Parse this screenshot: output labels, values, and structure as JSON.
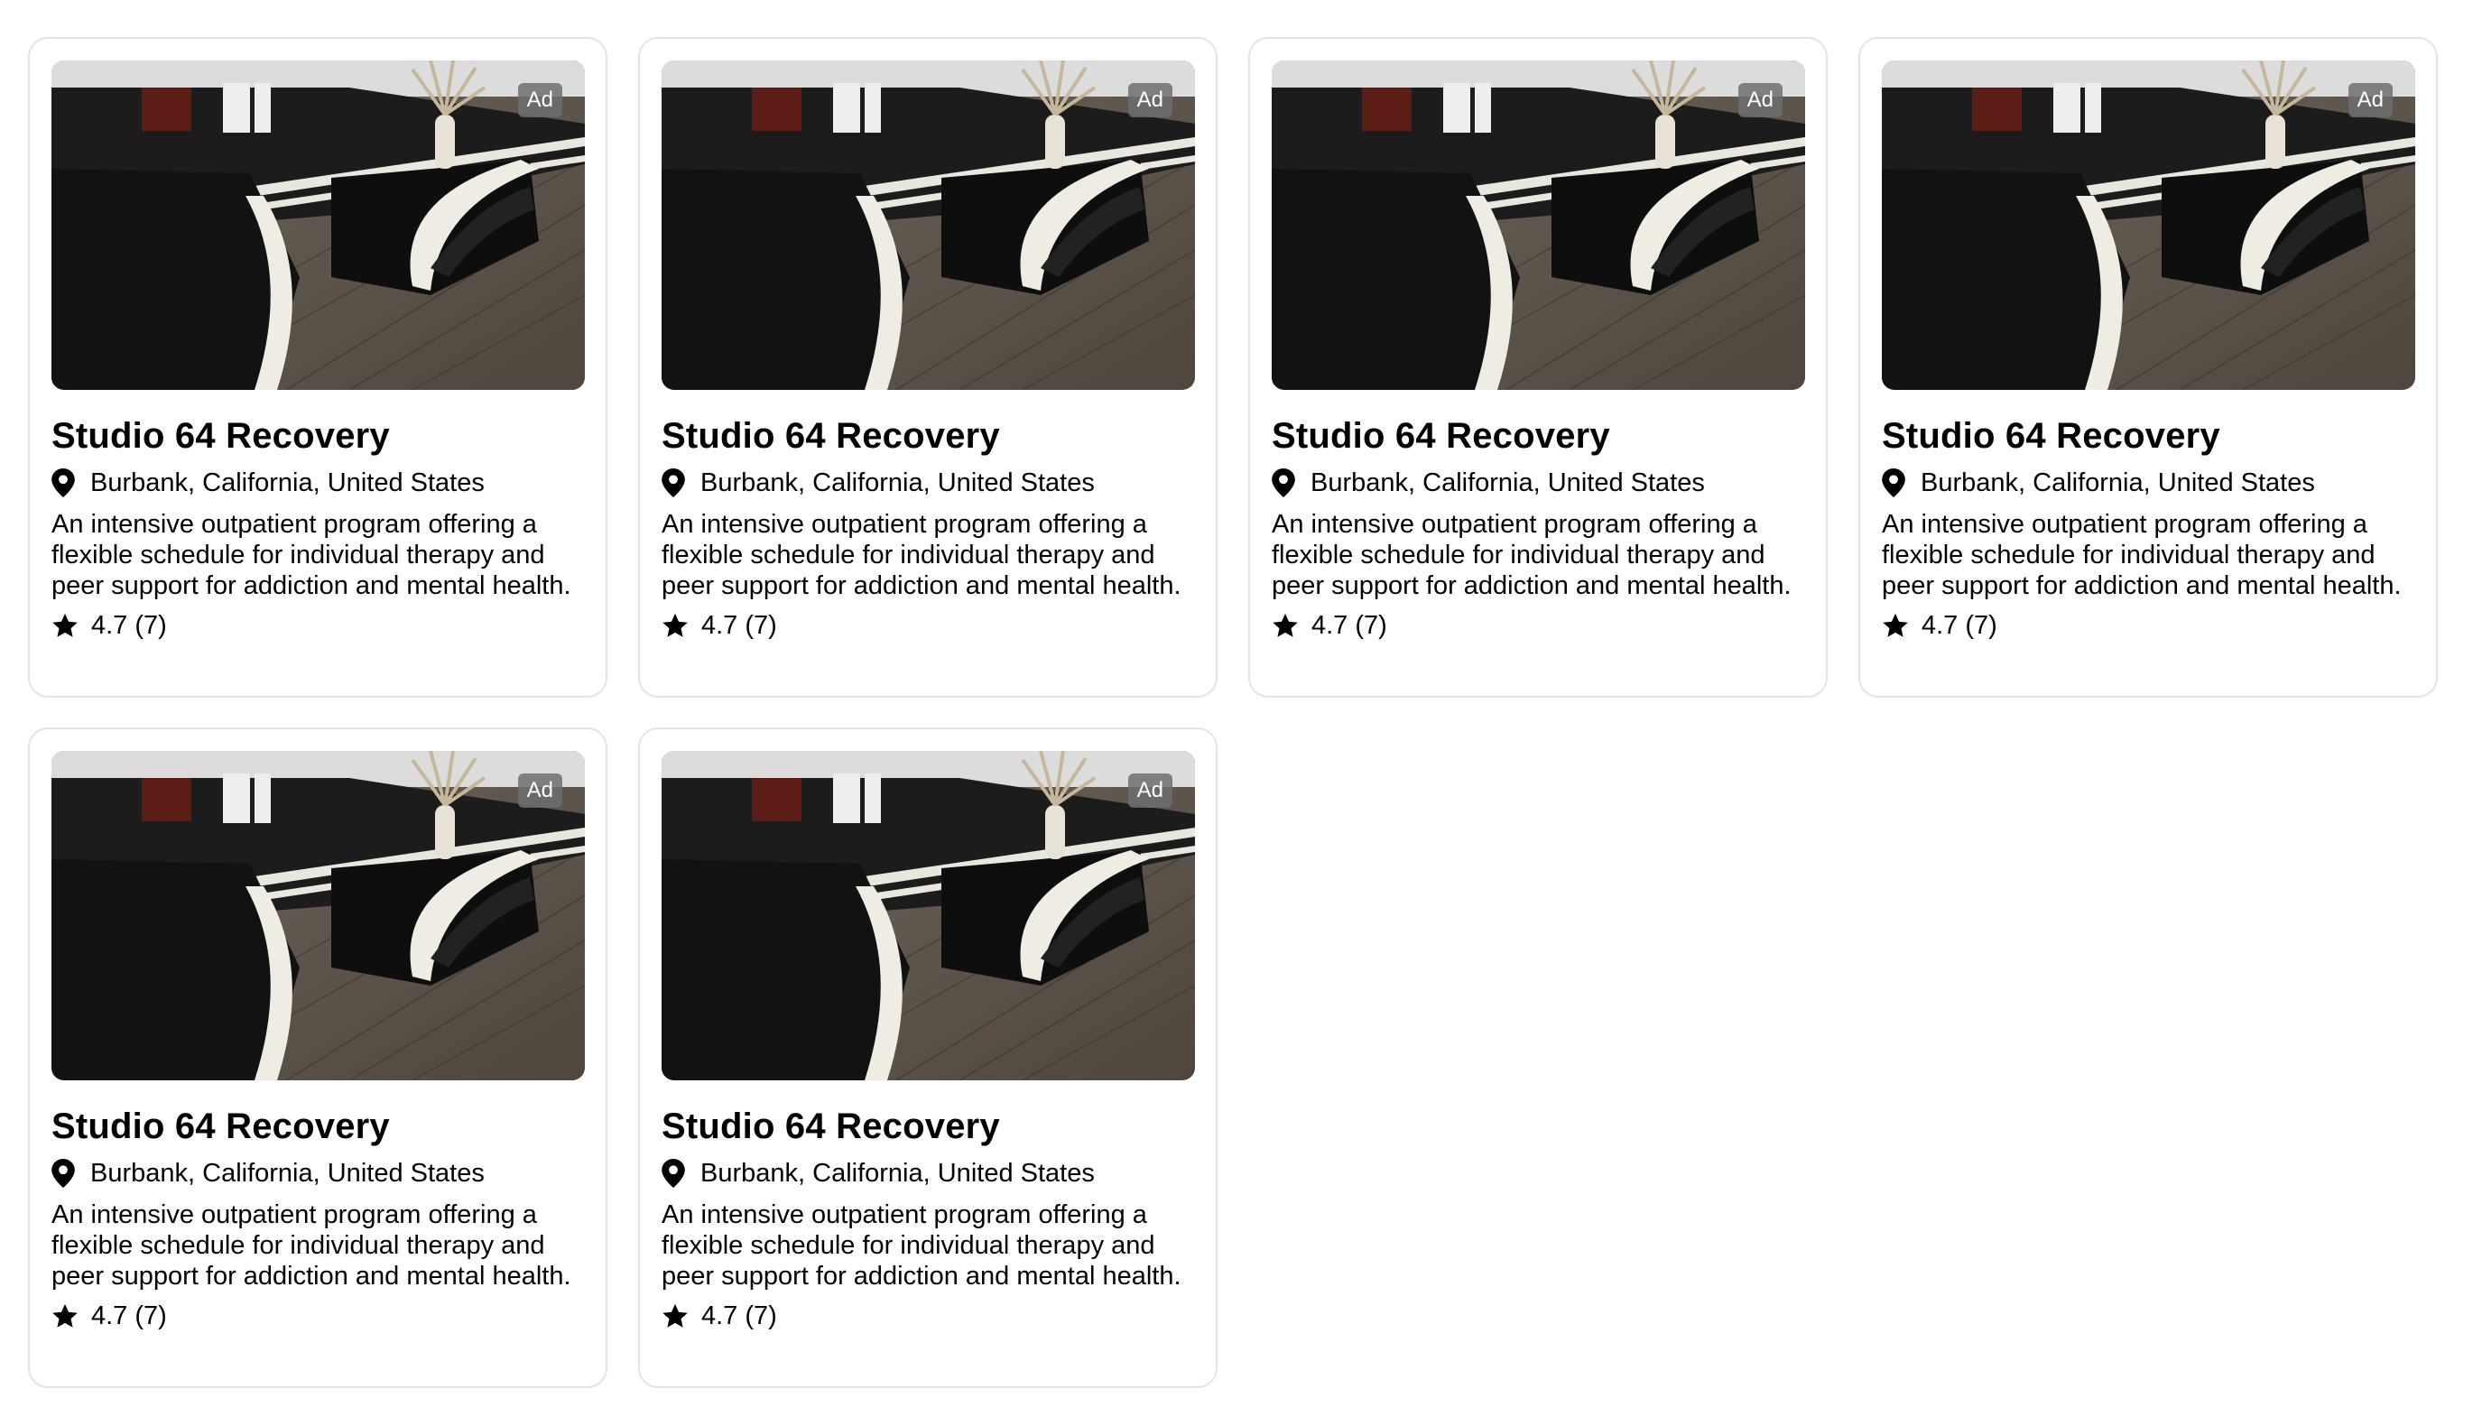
{
  "listings": [
    {
      "name": "Studio 64 Recovery",
      "badge": "Ad",
      "location": "Burbank, California, United States",
      "description": "An intensive outpatient program offering a flexible schedule for individual therapy and peer support for addiction and mental health.",
      "rating": "4.7 (7)"
    },
    {
      "name": "Studio 64 Recovery",
      "badge": "Ad",
      "location": "Burbank, California, United States",
      "description": "An intensive outpatient program offering a flexible schedule for individual therapy and peer support for addiction and mental health.",
      "rating": "4.7 (7)"
    },
    {
      "name": "Studio 64 Recovery",
      "badge": "Ad",
      "location": "Burbank, California, United States",
      "description": "An intensive outpatient program offering a flexible schedule for individual therapy and peer support for addiction and mental health.",
      "rating": "4.7 (7)"
    },
    {
      "name": "Studio 64 Recovery",
      "badge": "Ad",
      "location": "Burbank, California, United States",
      "description": "An intensive outpatient program offering a flexible schedule for individual therapy and peer support for addiction and mental health.",
      "rating": "4.7 (7)"
    },
    {
      "name": "Studio 64 Recovery",
      "badge": "Ad",
      "location": "Burbank, California, United States",
      "description": "An intensive outpatient program offering a flexible schedule for individual therapy and peer support for addiction and mental health.",
      "rating": "4.7 (7)"
    },
    {
      "name": "Studio 64 Recovery",
      "badge": "Ad",
      "location": "Burbank, California, United States",
      "description": "An intensive outpatient program offering a flexible schedule for individual therapy and peer support for addiction and mental health.",
      "rating": "4.7 (7)"
    }
  ],
  "icons": {
    "location": "map-pin-icon",
    "rating": "star-icon"
  },
  "colors": {
    "card_border": "#e3e3e3",
    "ad_badge_bg": "#6e6e6e",
    "text": "#000000"
  }
}
